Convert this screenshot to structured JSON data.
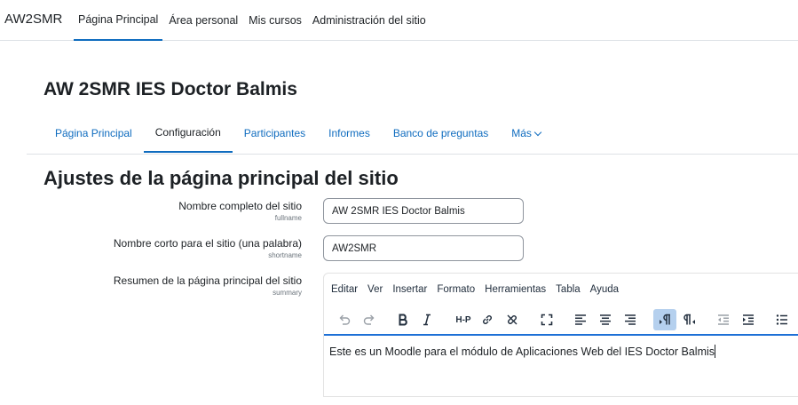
{
  "topbar": {
    "brand": "AW2SMR",
    "nav": [
      {
        "label": "Página Principal",
        "active": true
      },
      {
        "label": "Área personal",
        "active": false
      },
      {
        "label": "Mis cursos",
        "active": false
      },
      {
        "label": "Administración del sitio",
        "active": false
      }
    ]
  },
  "course": {
    "title": "AW 2SMR IES Doctor Balmis",
    "tabs": [
      {
        "label": "Página Principal",
        "active": false
      },
      {
        "label": "Configuración",
        "active": true
      },
      {
        "label": "Participantes",
        "active": false
      },
      {
        "label": "Informes",
        "active": false
      },
      {
        "label": "Banco de preguntas",
        "active": false
      },
      {
        "label": "Más",
        "active": false
      }
    ]
  },
  "page": {
    "heading": "Ajustes de la página principal del sitio"
  },
  "form": {
    "fullname": {
      "label": "Nombre completo del sitio",
      "field": "fullname",
      "value": "AW 2SMR IES Doctor Balmis"
    },
    "shortname": {
      "label": "Nombre corto para el sitio (una palabra)",
      "field": "shortname",
      "value": "AW2SMR"
    },
    "summary": {
      "label": "Resumen de la página principal del sitio",
      "field": "summary"
    }
  },
  "editor": {
    "menu": [
      "Editar",
      "Ver",
      "Insertar",
      "Formato",
      "Herramientas",
      "Tabla",
      "Ayuda"
    ],
    "toolbar": [
      "undo-icon",
      "redo-icon",
      "bold-icon",
      "italic-icon",
      "h5p-icon",
      "link-icon",
      "unlink-icon",
      "fullscreen-icon",
      "align-left-icon",
      "align-center-icon",
      "align-right-icon",
      "ltr-icon",
      "rtl-icon",
      "outdent-icon",
      "indent-icon",
      "bullet-list-icon"
    ],
    "h5p_label": "H-P",
    "content": "Este es un Moodle para el módulo de Aplicaciones Web del IES Doctor Balmis"
  },
  "colors": {
    "link": "#0f6cbf",
    "text": "#1d2125",
    "active_button": "#b5d0ee",
    "focus": "#1d70d6"
  }
}
